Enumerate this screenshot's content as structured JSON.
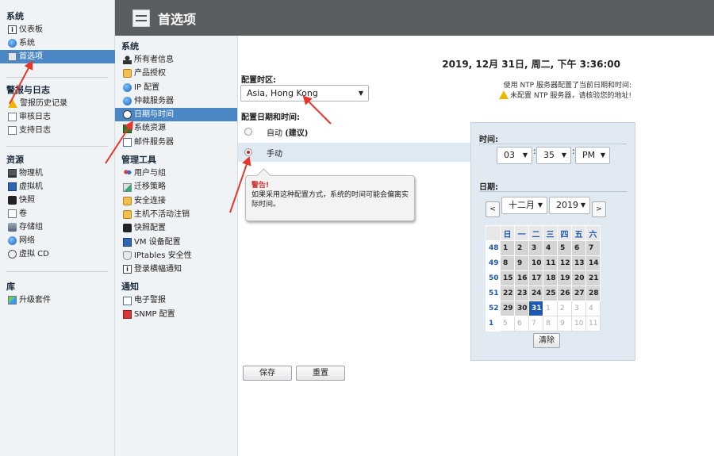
{
  "header": {
    "title": "首选项"
  },
  "leftnav": {
    "system": {
      "heading": "系统",
      "items": [
        {
          "label": "仪表板",
          "icon": "info-icon"
        },
        {
          "label": "系统",
          "icon": "globe-icon"
        },
        {
          "label": "首选项",
          "icon": "preferences-icon",
          "selected": true
        }
      ]
    },
    "alerts": {
      "heading": "警报与日志",
      "items": [
        {
          "label": "警报历史记录",
          "icon": "warning-icon"
        },
        {
          "label": "审核日志",
          "icon": "document-icon"
        },
        {
          "label": "支持日志",
          "icon": "document-icon"
        }
      ]
    },
    "resources": {
      "heading": "资源",
      "items": [
        {
          "label": "物理机",
          "icon": "monitor-icon"
        },
        {
          "label": "虚拟机",
          "icon": "vm-icon"
        },
        {
          "label": "快照",
          "icon": "camera-icon"
        },
        {
          "label": "卷",
          "icon": "volume-icon"
        },
        {
          "label": "存储组",
          "icon": "storage-icon"
        },
        {
          "label": "网络",
          "icon": "globe-icon"
        },
        {
          "label": "虚拟 CD",
          "icon": "cd-icon"
        }
      ]
    },
    "library": {
      "heading": "库",
      "items": [
        {
          "label": "升级套件",
          "icon": "upgrade-icon"
        }
      ]
    }
  },
  "midnav": {
    "system": {
      "heading": "系统",
      "items": [
        {
          "label": "所有者信息",
          "icon": "user-icon"
        },
        {
          "label": "产品授权",
          "icon": "lock-icon"
        },
        {
          "label": "IP 配置",
          "icon": "globe-icon"
        },
        {
          "label": "仲裁服务器",
          "icon": "globe-icon"
        },
        {
          "label": "日期与时间",
          "icon": "clock-icon",
          "selected": true
        },
        {
          "label": "系统资源",
          "icon": "chip-icon"
        },
        {
          "label": "邮件服务器",
          "icon": "mail-icon"
        }
      ]
    },
    "admin": {
      "heading": "管理工具",
      "items": [
        {
          "label": "用户与组",
          "icon": "users-icon"
        },
        {
          "label": "迁移策略",
          "icon": "migrate-icon"
        },
        {
          "label": "安全连接",
          "icon": "lock-icon"
        },
        {
          "label": "主机不活动注销",
          "icon": "lock-icon"
        },
        {
          "label": "快照配置",
          "icon": "camera-icon"
        },
        {
          "label": "VM 设备配置",
          "icon": "vm-icon"
        },
        {
          "label": "IPtables 安全性",
          "icon": "shield-icon"
        },
        {
          "label": "登录横幅通知",
          "icon": "info-icon"
        }
      ]
    },
    "notify": {
      "heading": "通知",
      "items": [
        {
          "label": "电子警报",
          "icon": "mail-icon"
        },
        {
          "label": "SNMP 配置",
          "icon": "snmp-icon"
        }
      ]
    }
  },
  "content": {
    "current_datetime": "2019, 12月 31日, 周二, 下午 3:36:00",
    "ntp_line1": "使用 NTP 服务器配置了当前日期和时间:",
    "ntp_line2": "未配置 NTP 服务器，请核验您的地址!",
    "timezone_label": "配置时区:",
    "timezone_value": "Asia, Hong Kong",
    "method_label": "配置日期和时间:",
    "option_auto": "自动",
    "option_auto_rec": "(建议)",
    "option_manual": "手动",
    "warning_title": "警告!",
    "warning_text": "如果采用这种配置方式，系统的时间可能会偏离实际时间。",
    "time_label": "时间:",
    "hour": "03",
    "minute": "35",
    "ampm": "PM",
    "date_label": "日期:",
    "month": "十二月",
    "year": "2019",
    "prev": "<",
    "next": ">",
    "weekdays": [
      "日",
      "一",
      "二",
      "三",
      "四",
      "五",
      "六"
    ],
    "calendar": [
      {
        "wk": "48",
        "days": [
          [
            "1",
            "d"
          ],
          [
            "2",
            "d"
          ],
          [
            "3",
            "d"
          ],
          [
            "4",
            "d"
          ],
          [
            "5",
            "d"
          ],
          [
            "6",
            "d"
          ],
          [
            "7",
            "d"
          ]
        ]
      },
      {
        "wk": "49",
        "days": [
          [
            "8",
            "d"
          ],
          [
            "9",
            "d"
          ],
          [
            "10",
            "d"
          ],
          [
            "11",
            "d"
          ],
          [
            "12",
            "d"
          ],
          [
            "13",
            "d"
          ],
          [
            "14",
            "d"
          ]
        ]
      },
      {
        "wk": "50",
        "days": [
          [
            "15",
            "d"
          ],
          [
            "16",
            "d"
          ],
          [
            "17",
            "d"
          ],
          [
            "18",
            "d"
          ],
          [
            "19",
            "d"
          ],
          [
            "20",
            "d"
          ],
          [
            "21",
            "d"
          ]
        ]
      },
      {
        "wk": "51",
        "days": [
          [
            "22",
            "d"
          ],
          [
            "23",
            "d"
          ],
          [
            "24",
            "d"
          ],
          [
            "25",
            "d"
          ],
          [
            "26",
            "d"
          ],
          [
            "27",
            "d"
          ],
          [
            "28",
            "d"
          ]
        ]
      },
      {
        "wk": "52",
        "days": [
          [
            "29",
            "d"
          ],
          [
            "30",
            "d"
          ],
          [
            "31",
            "sel"
          ],
          [
            "1",
            "o"
          ],
          [
            "2",
            "o"
          ],
          [
            "3",
            "o"
          ],
          [
            "4",
            "o"
          ]
        ]
      },
      {
        "wk": "1",
        "days": [
          [
            "5",
            "o"
          ],
          [
            "6",
            "o"
          ],
          [
            "7",
            "o"
          ],
          [
            "8",
            "o"
          ],
          [
            "9",
            "o"
          ],
          [
            "10",
            "o"
          ],
          [
            "11",
            "o"
          ]
        ]
      }
    ],
    "clear_label": "清除",
    "save_label": "保存",
    "reset_label": "重置"
  },
  "colors": {
    "accent": "#4b87c5",
    "header_bg": "#5b5e61",
    "arrow": "#e8352b",
    "selected_day": "#1f58b0"
  }
}
